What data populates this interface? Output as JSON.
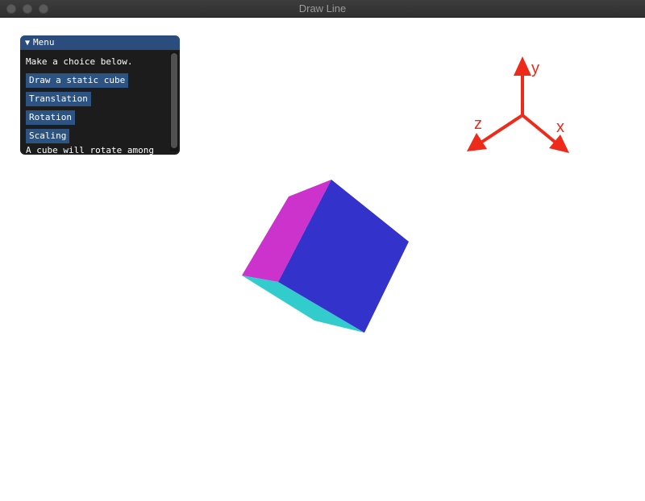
{
  "window": {
    "title": "Draw Line"
  },
  "menu": {
    "header": "Menu",
    "prompt": "Make a choice below.",
    "buttons": [
      "Draw a static cube",
      "Translation",
      "Rotation",
      "Scaling"
    ],
    "description": "A cube will rotate among"
  },
  "axes": {
    "x_label": "x",
    "y_label": "y",
    "z_label": "z",
    "color": "#ee2a1a"
  },
  "cube": {
    "top_color": "#cc33cc",
    "front_color": "#3333cc",
    "bottom_color": "#33cccc"
  }
}
